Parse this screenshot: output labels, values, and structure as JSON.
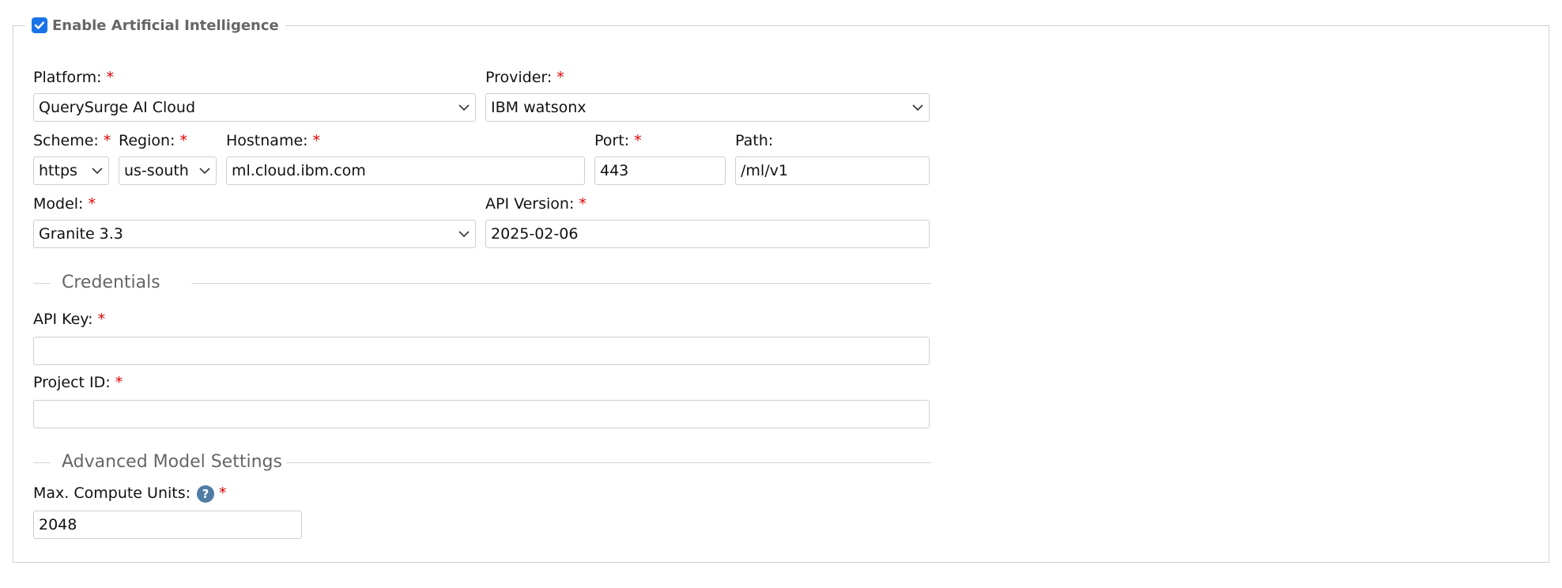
{
  "ai": {
    "enable_label": "Enable Artificial Intelligence",
    "enabled": true
  },
  "form": {
    "required_mark": "*",
    "platform": {
      "label": "Platform:",
      "value": "QuerySurge AI Cloud"
    },
    "provider": {
      "label": "Provider:",
      "value": "IBM watsonx"
    },
    "scheme": {
      "label": "Scheme:",
      "value": "https"
    },
    "region": {
      "label": "Region:",
      "value": "us-south"
    },
    "hostname": {
      "label": "Hostname:",
      "value": "ml.cloud.ibm.com"
    },
    "port": {
      "label": "Port:",
      "value": "443"
    },
    "path": {
      "label": "Path:",
      "value": "/ml/v1"
    },
    "model": {
      "label": "Model:",
      "value": "Granite 3.3"
    },
    "api_version": {
      "label": "API Version:",
      "value": "2025-02-06"
    }
  },
  "credentials": {
    "title": "Credentials",
    "api_key": {
      "label": "API Key:",
      "value": ""
    },
    "project_id": {
      "label": "Project ID:",
      "value": ""
    }
  },
  "advanced": {
    "title": "Advanced Model Settings",
    "max_compute": {
      "label": "Max. Compute Units:",
      "value": "2048",
      "help_icon": "?"
    }
  },
  "colors": {
    "required": "#e00000",
    "accent": "#1a73e8",
    "help": "#4f7ca3"
  }
}
